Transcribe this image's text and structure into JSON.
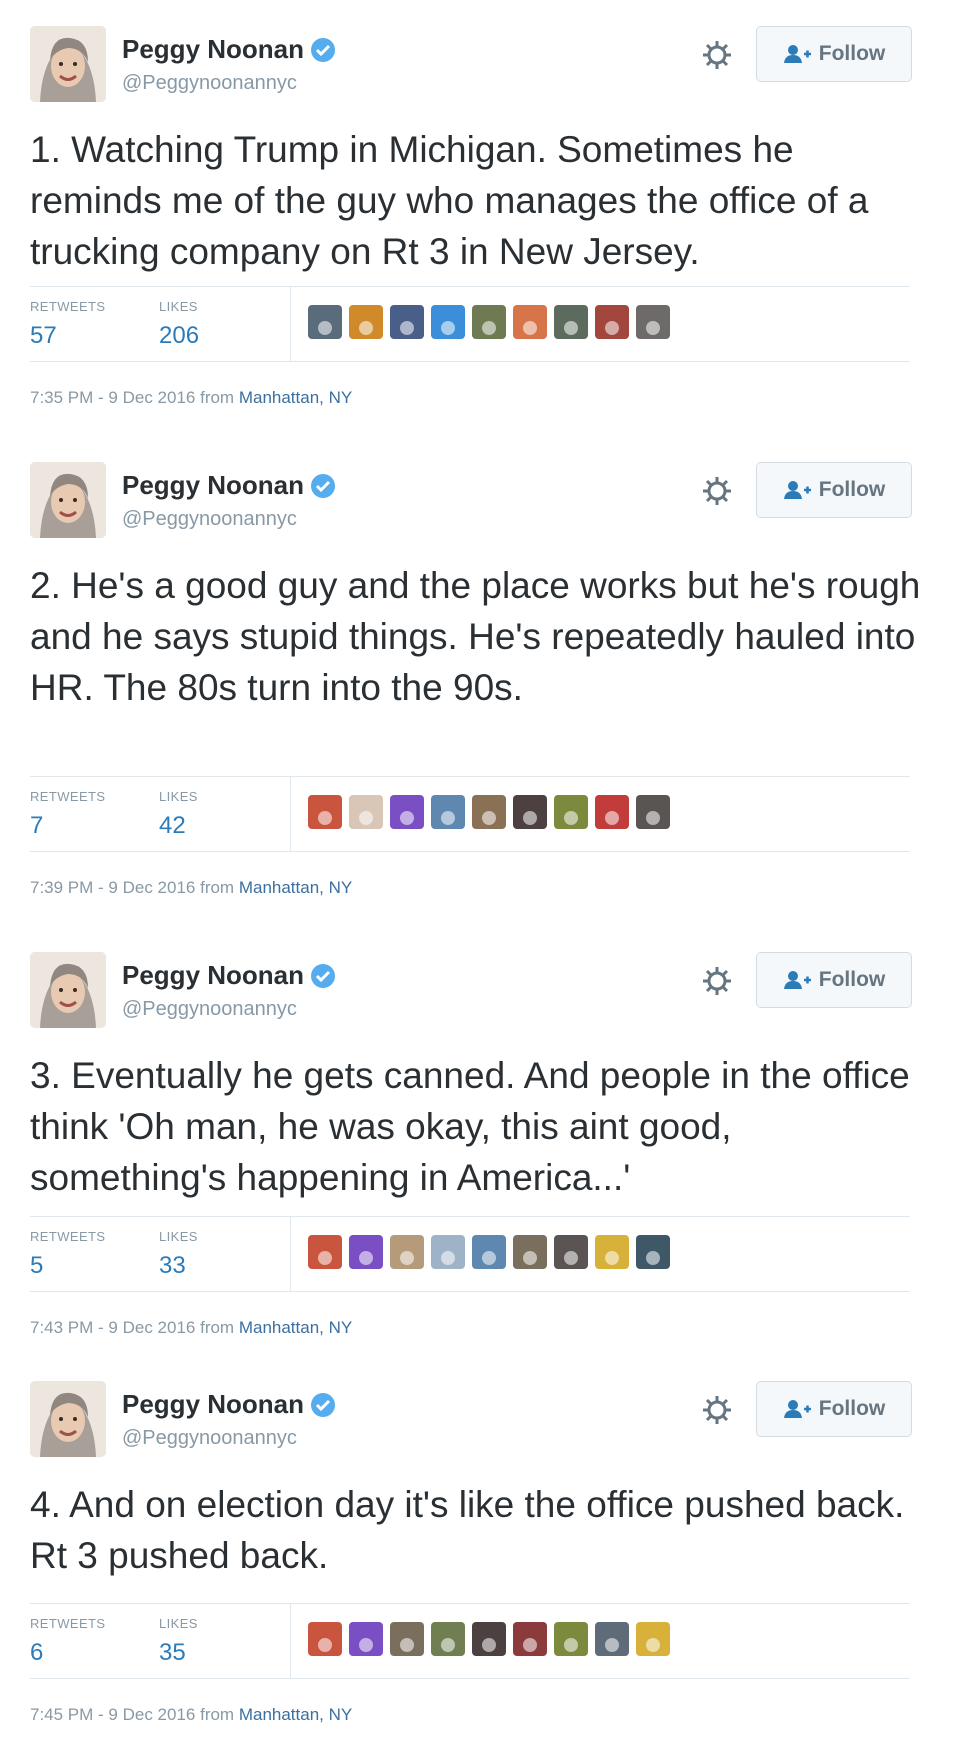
{
  "tweets": [
    {
      "name": "Peggy Noonan",
      "handle": "@Peggynoonannyc",
      "follow_label": "Follow",
      "text": "1. Watching Trump in Michigan. Sometimes he reminds me of the guy who manages the office of a trucking company on Rt 3 in New Jersey.",
      "retweets_label": "RETWEETS",
      "retweets": "57",
      "likes_label": "LIKES",
      "likes": "206",
      "time": "7:35 PM - 9 Dec 2016 from",
      "location": "Manhattan, NY",
      "liker_colors": [
        "#5a6b7c",
        "#d08a2a",
        "#4a5e8a",
        "#3b8fd9",
        "#6d7a52",
        "#d7744a",
        "#5d6a5e",
        "#a2463e",
        "#6f6a6a"
      ]
    },
    {
      "name": "Peggy Noonan",
      "handle": "@Peggynoonannyc",
      "follow_label": "Follow",
      "text": "2. He's a good guy and the place works but he's rough and he says stupid things. He's repeatedly hauled into HR. The 80s turn into the 90s.",
      "retweets_label": "RETWEETS",
      "retweets": "7",
      "likes_label": "LIKES",
      "likes": "42",
      "time": "7:39 PM - 9 Dec 2016 from",
      "location": "Manhattan, NY",
      "liker_colors": [
        "#c9553f",
        "#d9c6b6",
        "#7b4fc4",
        "#5e88b0",
        "#8a7155",
        "#4d4040",
        "#7c8a3d",
        "#c23c3c",
        "#5a5452"
      ]
    },
    {
      "name": "Peggy Noonan",
      "handle": "@Peggynoonannyc",
      "follow_label": "Follow",
      "text": "3. Eventually he gets canned. And people in the office think 'Oh man, he was okay, this aint good, something's happening in America...'",
      "retweets_label": "RETWEETS",
      "retweets": "5",
      "likes_label": "LIKES",
      "likes": "33",
      "time": "7:43 PM - 9 Dec 2016 from",
      "location": "Manhattan, NY",
      "liker_colors": [
        "#c9553f",
        "#7b4fc4",
        "#b59b7a",
        "#9fb3c8",
        "#5e88b0",
        "#7a6f5d",
        "#5a5452",
        "#d8b13a",
        "#3f5868"
      ]
    },
    {
      "name": "Peggy Noonan",
      "handle": "@Peggynoonannyc",
      "follow_label": "Follow",
      "text": "4. And on election day it's like the office pushed back. Rt 3 pushed back.",
      "retweets_label": "RETWEETS",
      "retweets": "6",
      "likes_label": "LIKES",
      "likes": "35",
      "time": "7:45 PM - 9 Dec 2016 from",
      "location": "Manhattan, NY",
      "liker_colors": [
        "#c9553f",
        "#7b4fc4",
        "#7a6f5d",
        "#6f7f52",
        "#4d4040",
        "#8b3b3b",
        "#7c8a3d",
        "#5e6b78",
        "#d8b13a"
      ]
    }
  ]
}
